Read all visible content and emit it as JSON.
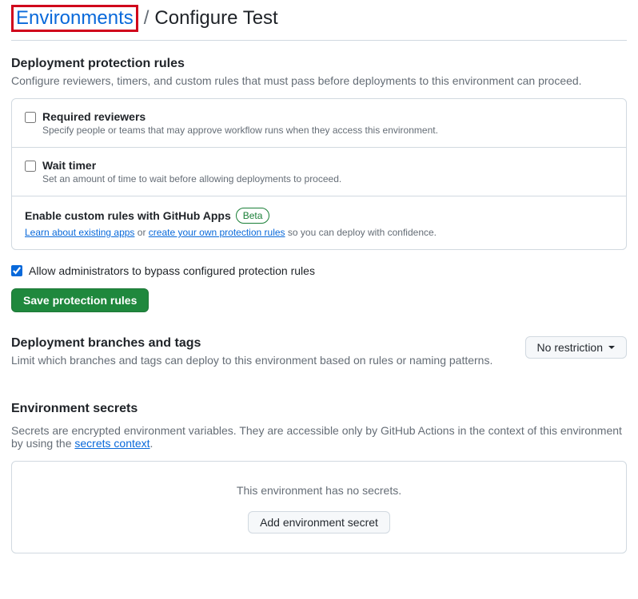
{
  "breadcrumb": {
    "link_label": "Environments",
    "separator": "/",
    "current": "Configure Test"
  },
  "protection": {
    "heading": "Deployment protection rules",
    "desc": "Configure reviewers, timers, and custom rules that must pass before deployments to this environment can proceed.",
    "required_reviewers": {
      "label": "Required reviewers",
      "desc": "Specify people or teams that may approve workflow runs when they access this environment."
    },
    "wait_timer": {
      "label": "Wait timer",
      "desc": "Set an amount of time to wait before allowing deployments to proceed."
    },
    "custom_apps": {
      "title": "Enable custom rules with GitHub Apps",
      "badge": "Beta",
      "link_existing": "Learn about existing apps",
      "or_text": " or ",
      "link_create": "create your own protection rules",
      "tail_text": " so you can deploy with confidence."
    },
    "bypass_label": "Allow administrators to bypass configured protection rules",
    "save_button": "Save protection rules"
  },
  "branches": {
    "heading": "Deployment branches and tags",
    "desc": "Limit which branches and tags can deploy to this environment based on rules or naming patterns.",
    "dropdown_label": "No restriction"
  },
  "secrets": {
    "heading": "Environment secrets",
    "desc_prefix": "Secrets are encrypted environment variables. They are accessible only by GitHub Actions in the context of this environment by using the ",
    "desc_link": "secrets context",
    "desc_suffix": ".",
    "empty_message": "This environment has no secrets.",
    "add_button": "Add environment secret"
  }
}
